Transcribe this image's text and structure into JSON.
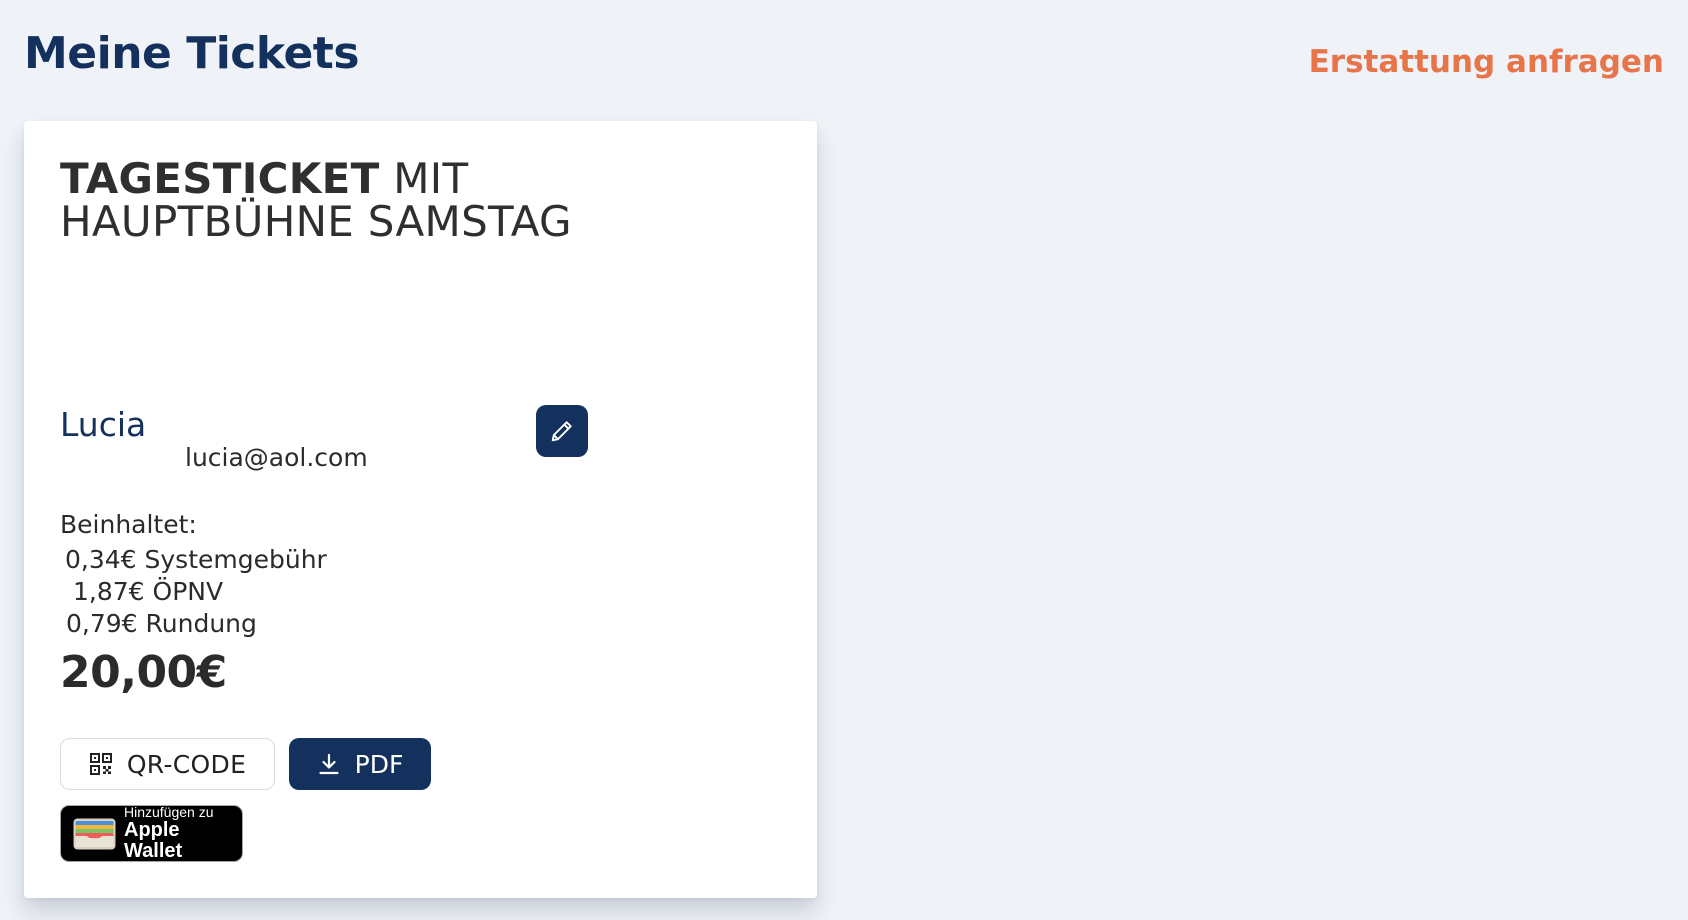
{
  "header": {
    "title": "Meine Tickets",
    "refund_link": "Erstattung anfragen"
  },
  "ticket": {
    "title_strong": "Tagesticket",
    "title_rest": " mit Hauptbühne Samstag",
    "holder_name": "Lucia",
    "holder_email": "lucia@aol.com",
    "includes_label": "Beinhaltet:",
    "fees": [
      "0,34€ Systemgebühr",
      "1,87€ ÖPNV",
      "0,79€ Rundung"
    ],
    "price": "20,00€",
    "qr_button_label": "QR-CODE",
    "pdf_button_label": "PDF",
    "wallet": {
      "line1": "Hinzufügen zu",
      "line2": "Apple Wallet"
    }
  },
  "icons": {
    "edit": "pencil-icon",
    "qr": "qr-code-icon",
    "download": "download-icon",
    "wallet": "apple-wallet-icon"
  },
  "colors": {
    "brand_navy": "#14315e",
    "accent_orange": "#e8744a",
    "page_background": "#eff2f7",
    "card_background": "#ffffff"
  }
}
